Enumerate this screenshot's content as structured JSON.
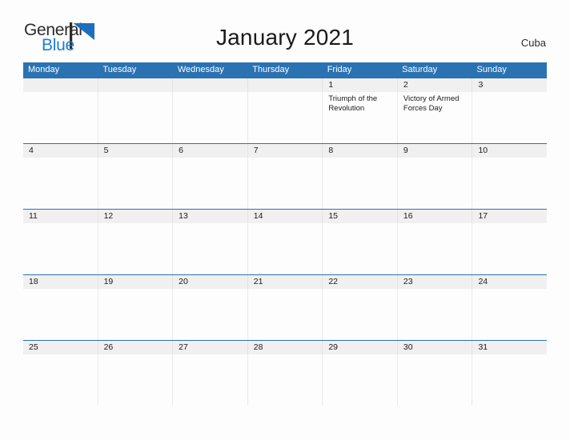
{
  "brand": {
    "word_one": "General",
    "word_two": "Blue",
    "flag_icon": "flag-triangle-icon",
    "word_one_color": "#2b2b2b",
    "word_two_color": "#1d7ed8",
    "flag_color": "#1d6fbe"
  },
  "header": {
    "title": "January 2021",
    "region": "Cuba"
  },
  "theme": {
    "header_row_bg": "#2b72b2",
    "header_row_text": "#ffffff",
    "date_row_bg": "#f0f0f0",
    "week_rule": "#2b72b2",
    "page_bg": "#fdfdfd",
    "body_text": "#1a1a1a"
  },
  "calendar": {
    "weekdays": [
      "Monday",
      "Tuesday",
      "Wednesday",
      "Thursday",
      "Friday",
      "Saturday",
      "Sunday"
    ],
    "weeks": [
      {
        "dates": [
          "",
          "",
          "",
          "",
          "1",
          "2",
          "3"
        ],
        "events": [
          "",
          "",
          "",
          "",
          "Triumph of the Revolution",
          "Victory of Armed Forces Day",
          ""
        ]
      },
      {
        "dates": [
          "4",
          "5",
          "6",
          "7",
          "8",
          "9",
          "10"
        ],
        "events": [
          "",
          "",
          "",
          "",
          "",
          "",
          ""
        ]
      },
      {
        "dates": [
          "11",
          "12",
          "13",
          "14",
          "15",
          "16",
          "17"
        ],
        "events": [
          "",
          "",
          "",
          "",
          "",
          "",
          ""
        ]
      },
      {
        "dates": [
          "18",
          "19",
          "20",
          "21",
          "22",
          "23",
          "24"
        ],
        "events": [
          "",
          "",
          "",
          "",
          "",
          "",
          ""
        ]
      },
      {
        "dates": [
          "25",
          "26",
          "27",
          "28",
          "29",
          "30",
          "31"
        ],
        "events": [
          "",
          "",
          "",
          "",
          "",
          "",
          ""
        ]
      }
    ]
  }
}
